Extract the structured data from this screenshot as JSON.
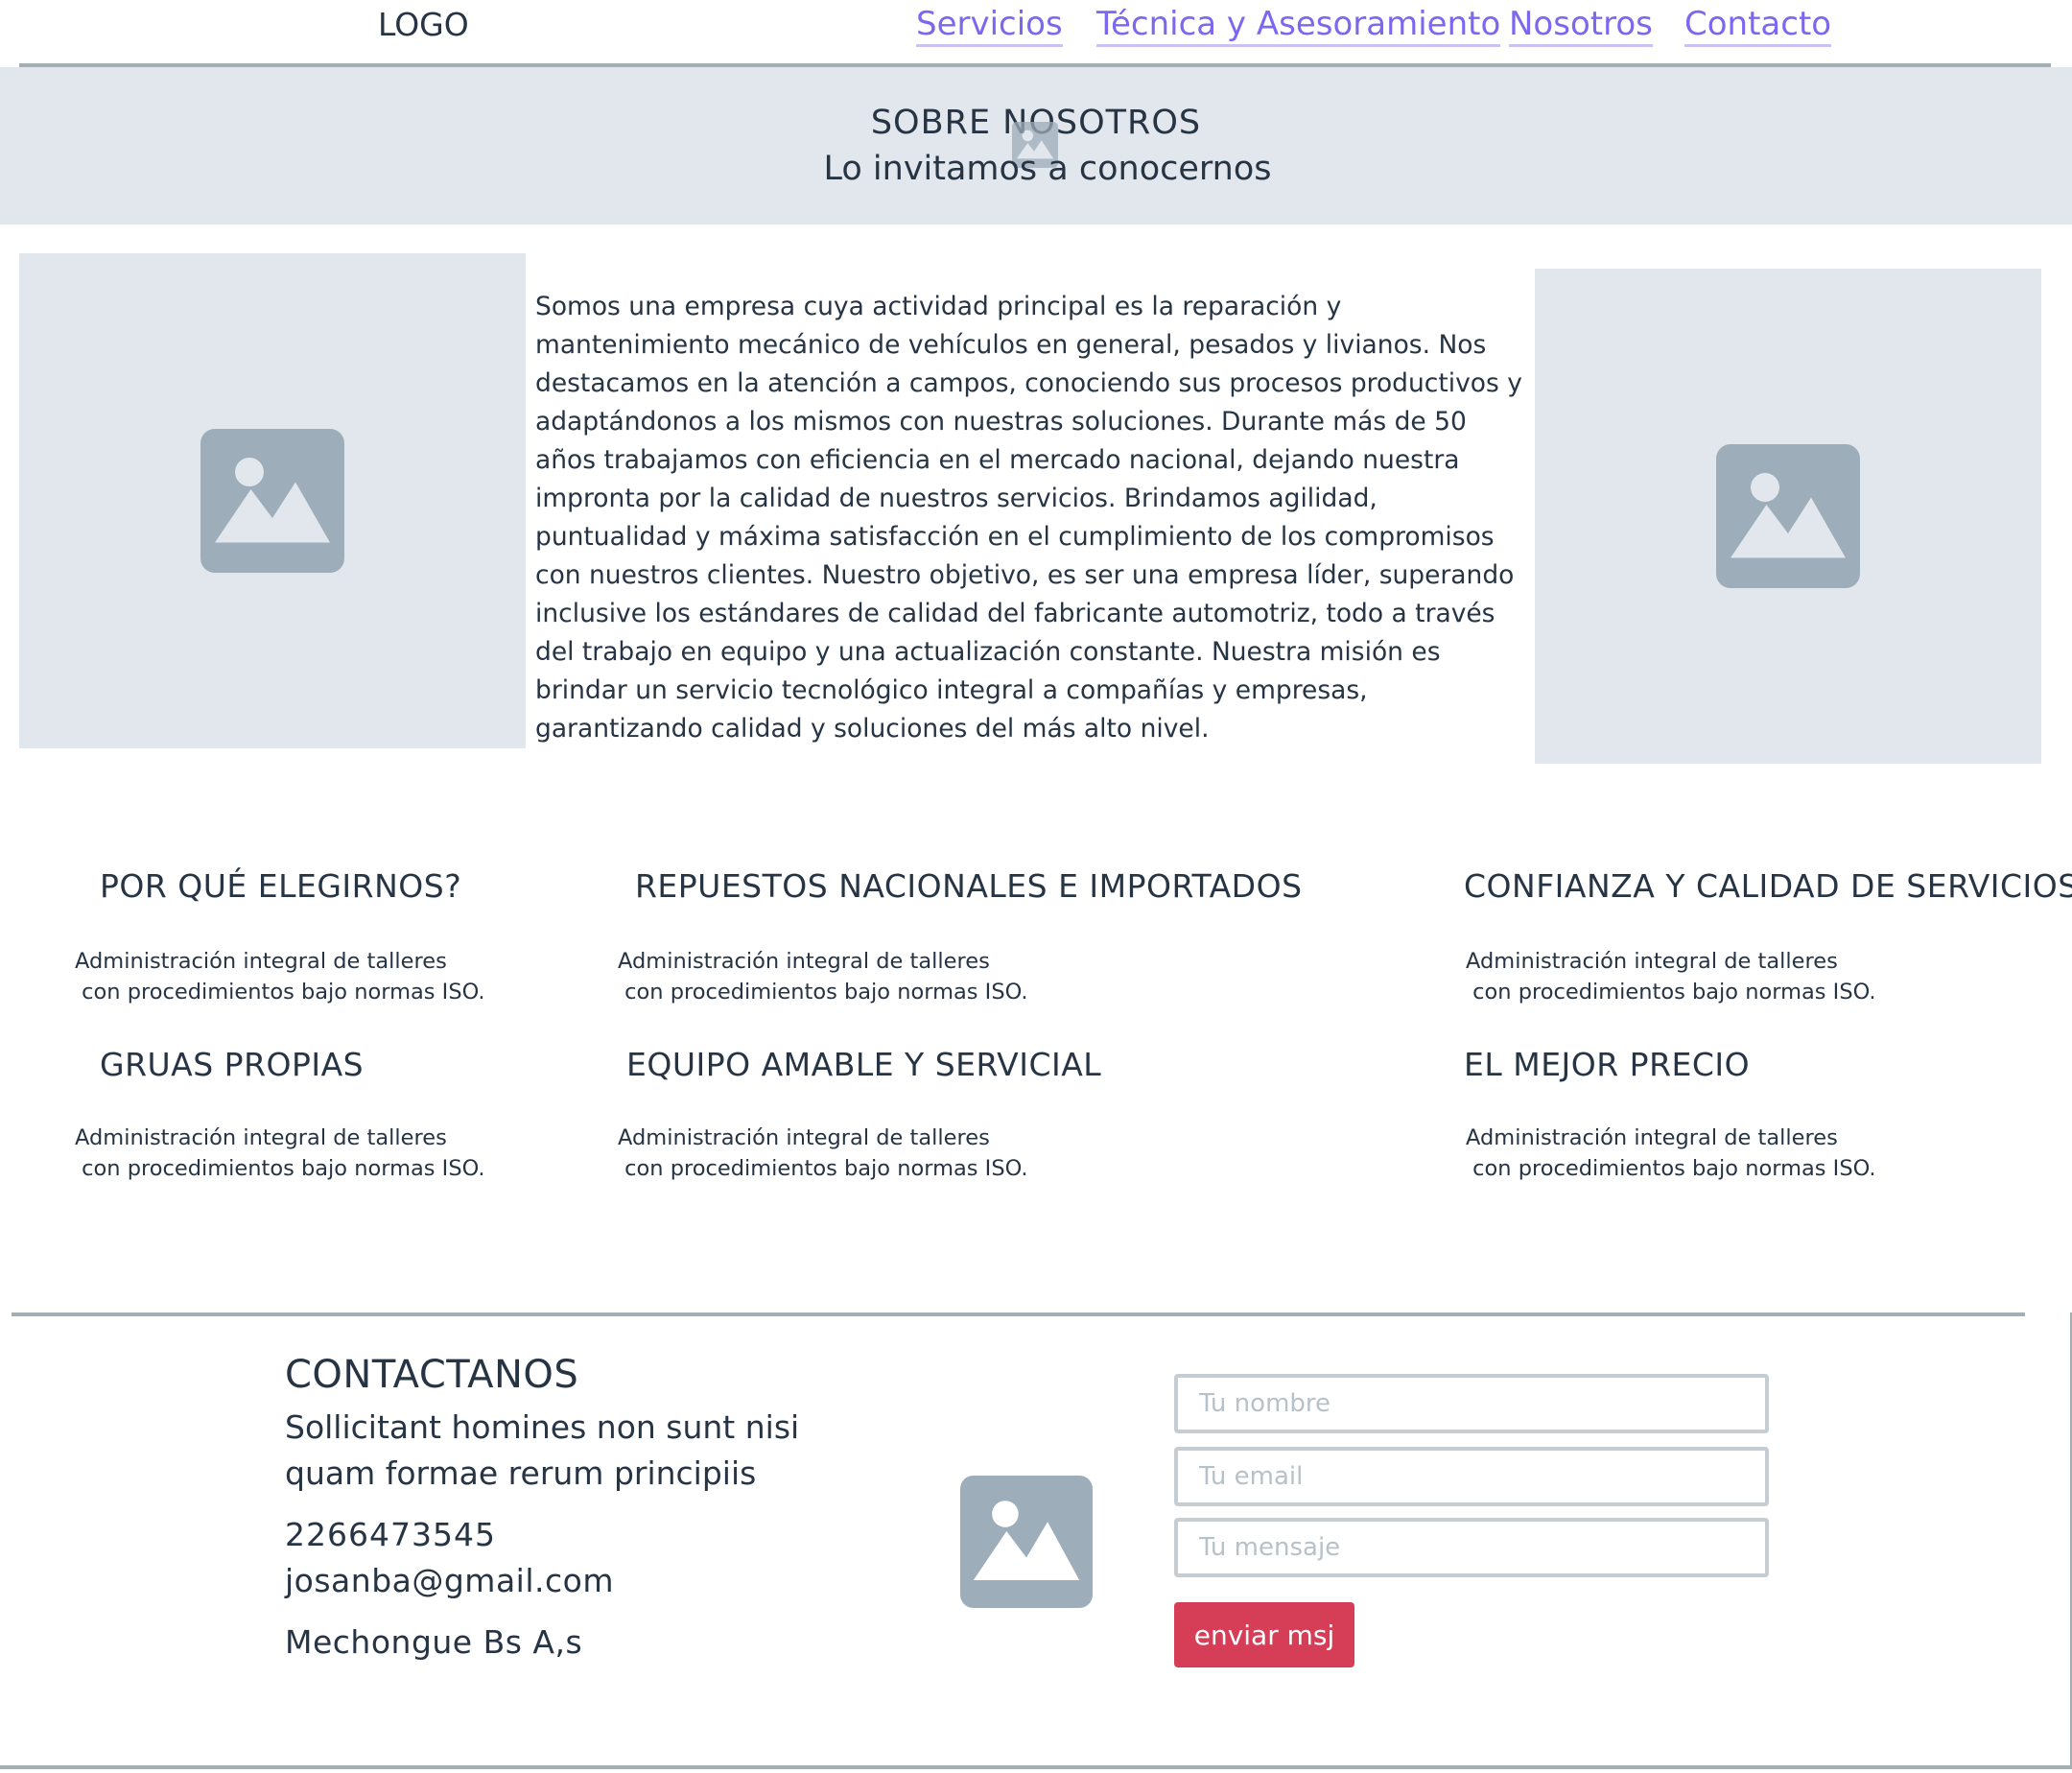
{
  "header": {
    "logo": "LOGO",
    "nav": [
      {
        "label": "Servicios"
      },
      {
        "label": "Técnica y Asesoramiento"
      },
      {
        "label": "Nosotros"
      },
      {
        "label": "Contacto"
      }
    ]
  },
  "hero": {
    "title": "SOBRE NOSOTROS",
    "subtitle": "Lo invitamos a conocernos",
    "icon": "image-placeholder-icon"
  },
  "about": {
    "text": "Somos una empresa cuya actividad principal es la reparación y mantenimiento mecánico de vehículos en general, pesados y livianos. Nos destacamos en la atención a campos, conociendo sus procesos productivos y adaptándonos a los mismos con nuestras soluciones. Durante más de 50 años trabajamos con eficiencia en el mercado nacional, dejando nuestra impronta por la calidad de nuestros servicios. Brindamos agilidad, puntualidad y máxima satisfacción en el cumplimiento de los compromisos con nuestros clientes. Nuestro objetivo, es ser una empresa líder, superando inclusive los estándares de calidad del fabricante automotriz, todo a través del trabajo en equipo y una actualización constante. Nuestra misión es brindar un servicio tecnológico integral a compañías y empresas, garantizando calidad y soluciones del más alto nivel."
  },
  "features": [
    {
      "title": "POR QUÉ ELEGIRNOS?",
      "desc": "Administración integral de talleres\n con procedimientos bajo normas ISO."
    },
    {
      "title": "REPUESTOS NACIONALES E IMPORTADOS",
      "desc": "Administración integral de talleres\n con procedimientos bajo normas ISO."
    },
    {
      "title": "CONFIANZA Y CALIDAD DE SERVICIOS",
      "desc": "Administración integral de talleres\n con procedimientos bajo normas ISO."
    },
    {
      "title": "GRUAS PROPIAS",
      "desc": "Administración integral de talleres\n con procedimientos bajo normas ISO."
    },
    {
      "title": "EQUIPO AMABLE Y SERVICIAL",
      "desc": "Administración integral de talleres\n con procedimientos bajo normas ISO."
    },
    {
      "title": "EL MEJOR PRECIO",
      "desc": "Administración integral de talleres\n con procedimientos bajo normas ISO."
    }
  ],
  "contact": {
    "title": "CONTACTANOS",
    "text": "Sollicitant homines non sunt nisi quam formae rerum principiis",
    "phone": "2266473545",
    "email": "josanba@gmail.com",
    "location": "Mechongue Bs A,s",
    "form": {
      "name_placeholder": "Tu nombre",
      "email_placeholder": "Tu email",
      "message_placeholder": "Tu mensaje",
      "submit_label": "enviar msj"
    }
  },
  "colors": {
    "link": "#7b68ee",
    "placeholder_bg": "#e1e7ec",
    "icon": "#9eadba",
    "text": "#273444",
    "button": "#d63e58"
  }
}
